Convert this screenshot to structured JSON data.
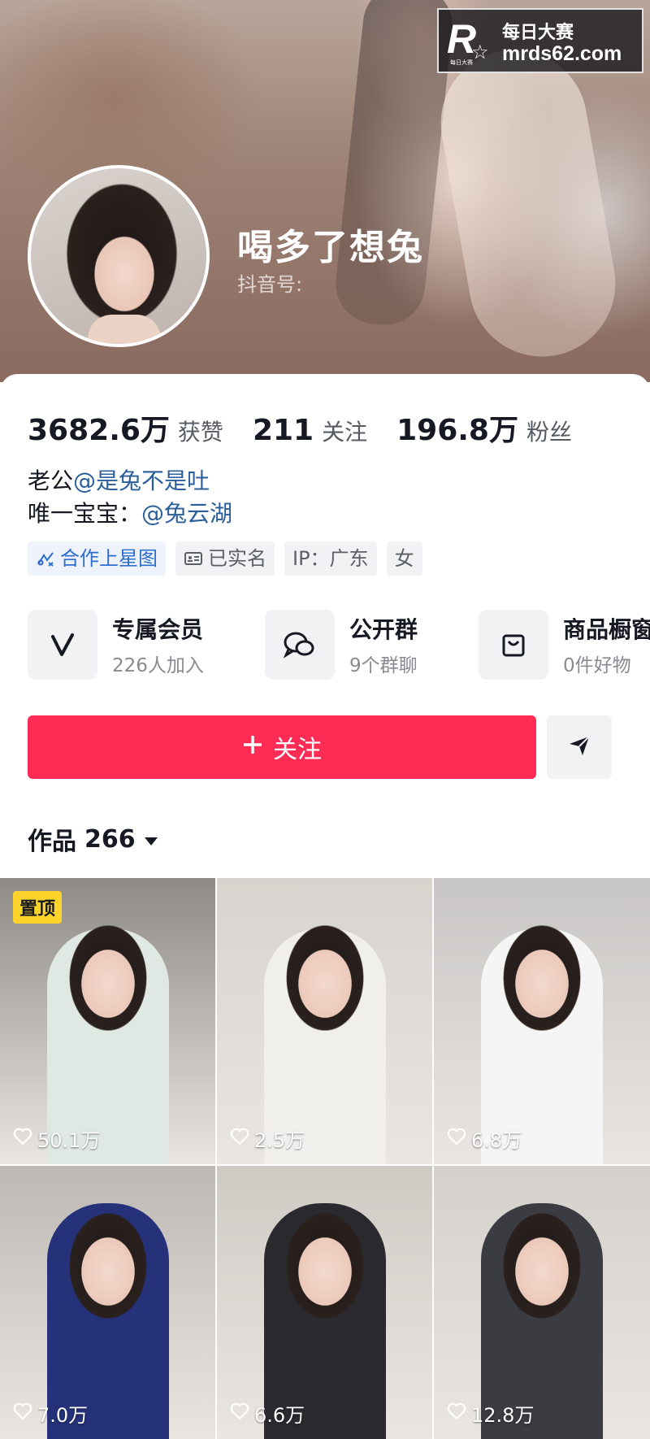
{
  "watermark": {
    "logo_letter": "R",
    "logo_small_text": "每日大赛",
    "title": "每日大赛",
    "url": "mrds62.com"
  },
  "profile": {
    "name": "喝多了想兔",
    "douyin_id_label": "抖音号:"
  },
  "stats": [
    {
      "value": "3682.6万",
      "label": "获赞"
    },
    {
      "value": "211",
      "label": "关注"
    },
    {
      "value": "196.8万",
      "label": "粉丝"
    }
  ],
  "bio": {
    "line1_prefix": "老公",
    "line1_mention": "@是兔不是吐",
    "line2_prefix": "唯一宝宝：",
    "line2_mention": "@兔云湖"
  },
  "tags": [
    {
      "label": "合作上星图",
      "icon": "star-map-icon"
    },
    {
      "label": "已实名",
      "icon": "id-card-icon"
    },
    {
      "label": "IP：广东",
      "icon": ""
    },
    {
      "label": "女",
      "icon": ""
    }
  ],
  "services": [
    {
      "title": "专属会员",
      "subtitle": "226人加入",
      "icon": "vip-v-icon"
    },
    {
      "title": "公开群",
      "subtitle": "9个群聊",
      "icon": "chat-bubbles-icon"
    },
    {
      "title": "商品橱窗",
      "subtitle": "0件好物",
      "icon": "shopping-bag-icon"
    }
  ],
  "actions": {
    "follow_label": "关注",
    "follow_icon": "plus-icon",
    "share_icon": "send-icon"
  },
  "works": {
    "label": "作品",
    "count": "266",
    "dropdown_icon": "caret-down-icon"
  },
  "videos": [
    {
      "likes": "50.1万",
      "pinned_label": "置顶",
      "bg": "#8e8a86",
      "outfit": "#dfe8e2"
    },
    {
      "likes": "2.5万",
      "pinned_label": "",
      "bg": "#d7d3ce",
      "outfit": "#f1efec"
    },
    {
      "likes": "6.8万",
      "pinned_label": "",
      "bg": "#c8c6c4",
      "outfit": "#f5f5f5"
    },
    {
      "likes": "7.0万",
      "pinned_label": "",
      "bg": "#bdb8b4",
      "outfit": "#25327a"
    },
    {
      "likes": "6.6万",
      "pinned_label": "",
      "bg": "#cfcac4",
      "outfit": "#2a2a2e"
    },
    {
      "likes": "12.8万",
      "pinned_label": "",
      "bg": "#d4d0cb",
      "outfit": "#3a3c42"
    }
  ],
  "colors": {
    "accent": "#fe2c55",
    "mention": "#2b5f9b",
    "tag_blue": "#2d6dcd",
    "pinned": "#fdd42b"
  }
}
